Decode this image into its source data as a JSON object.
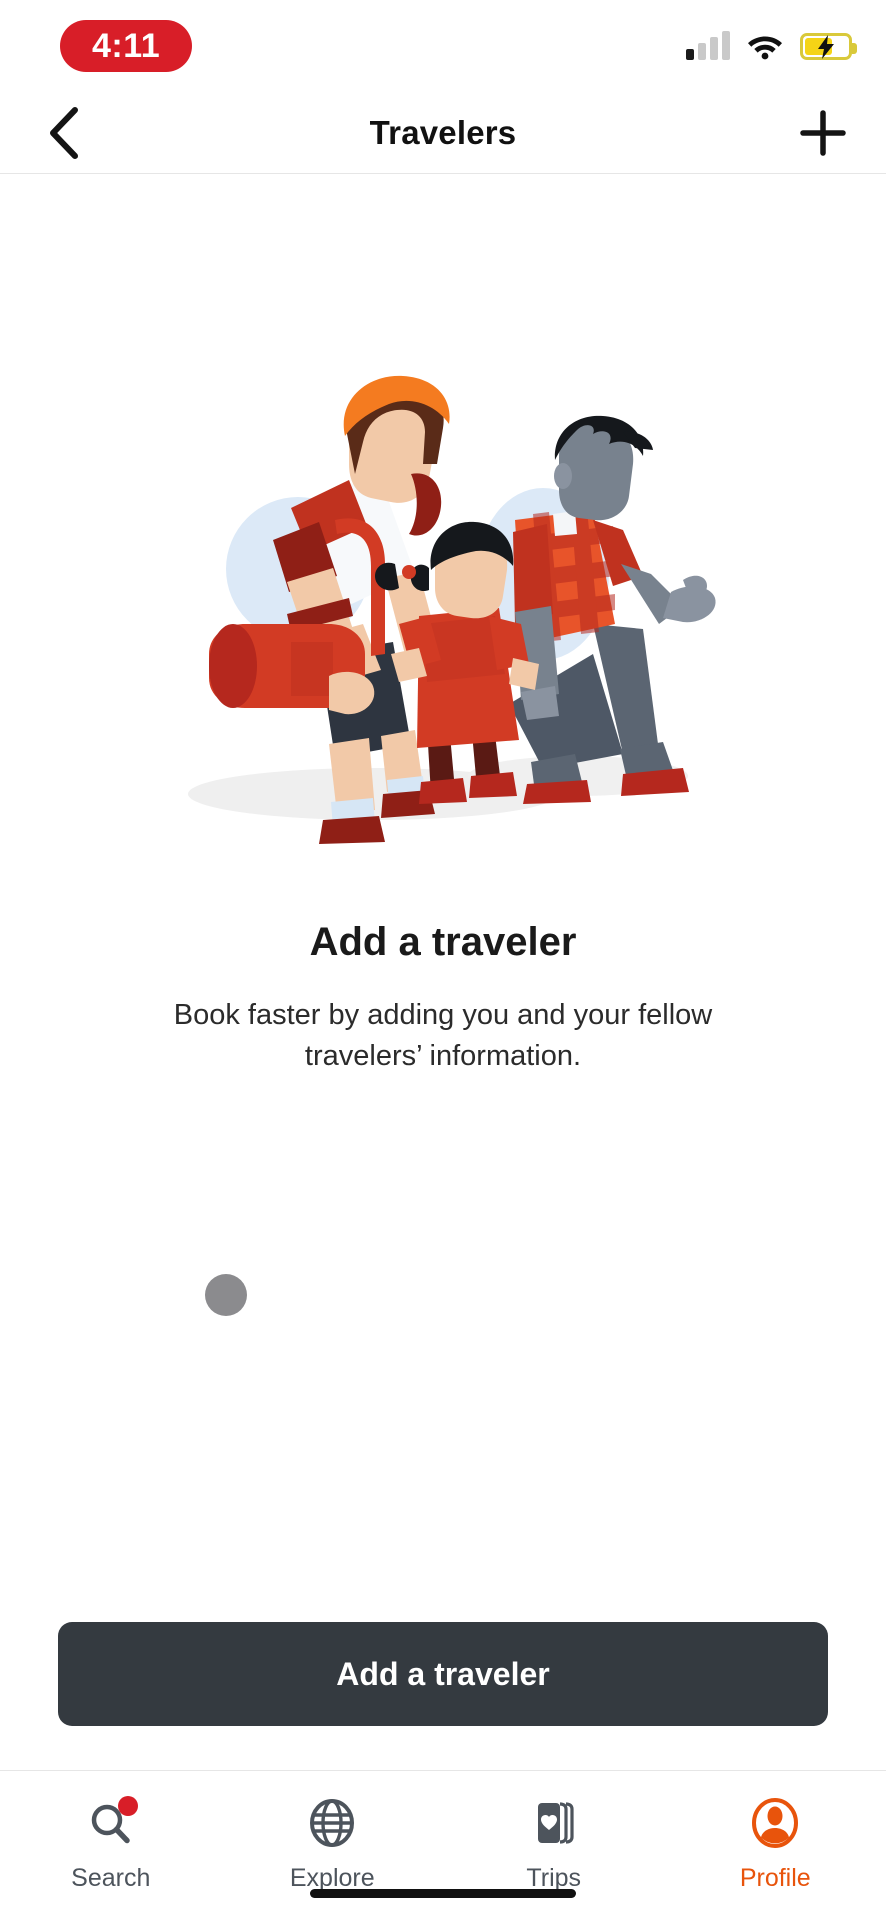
{
  "status_bar": {
    "time": "4:11",
    "time_pill_color": "#D81E28",
    "signal_icon": "cellular-signal-icon",
    "wifi_icon": "wifi-icon",
    "battery_icon": "battery-charging-icon",
    "battery_color": "#F5D416"
  },
  "nav_bar": {
    "back_icon": "back-chevron-icon",
    "title": "Travelers",
    "add_icon": "plus-icon"
  },
  "main": {
    "illustration": "family-travelers-illustration",
    "headline": "Add a traveler",
    "subtext": "Book faster by adding you and your fellow travelers’ information.",
    "cursor": "cursor-dot"
  },
  "cta": {
    "label": "Add a traveler",
    "background": "#343a40",
    "text_color": "#ffffff"
  },
  "tab_bar": {
    "active_color": "#E8540C",
    "inactive_color": "#4d545c",
    "items": [
      {
        "label": "Search",
        "icon": "search-icon",
        "active": false,
        "badge": true
      },
      {
        "label": "Explore",
        "icon": "globe-icon",
        "active": false,
        "badge": false
      },
      {
        "label": "Trips",
        "icon": "cards-heart-icon",
        "active": false,
        "badge": false
      },
      {
        "label": "Profile",
        "icon": "profile-avatar-icon",
        "active": true,
        "badge": false
      }
    ]
  },
  "home_indicator": "home-indicator"
}
